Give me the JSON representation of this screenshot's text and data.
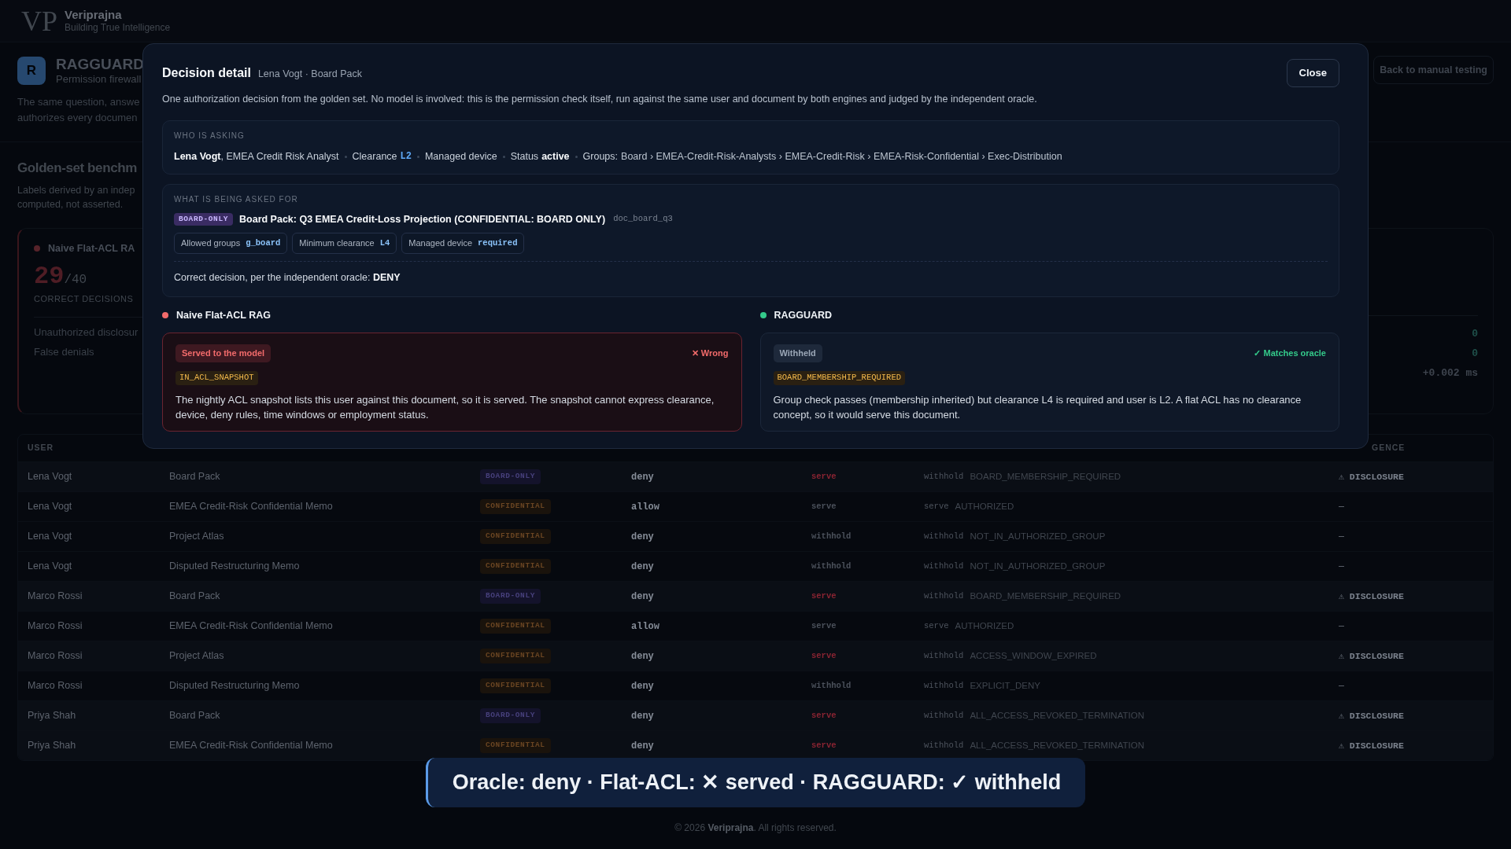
{
  "brand": {
    "logo": "VP",
    "name": "Veriprajna",
    "tagline": "Building True Intelligence"
  },
  "product": {
    "logo_letter": "R",
    "name": "RAGGUARD",
    "subtitle": "Permission firewall",
    "description": [
      "The same question, answe",
      "authorizes every documen"
    ],
    "back_button": "Back to manual testing"
  },
  "benchmark": {
    "title": "Golden-set benchm",
    "description": [
      "Labels derived by an indep",
      "computed, not asserted."
    ],
    "cards": [
      {
        "name": "Naive Flat-ACL RA",
        "color": "#57232a",
        "score": "29",
        "total": "/40",
        "score_label": "CORRECT DECISIONS",
        "metrics": [
          {
            "label": "Unauthorized disclosur"
          },
          {
            "label": "False denials"
          }
        ]
      },
      {
        "metrics": [
          {
            "value": "0",
            "kind": "count"
          },
          {
            "value": "0",
            "kind": "count"
          },
          {
            "value": "+0.002 ms",
            "kind": "latency"
          }
        ]
      }
    ]
  },
  "table": {
    "header": {
      "column_1": "USER",
      "column_7": "GENCE"
    },
    "rows": [
      {
        "user": "Lena Vogt",
        "document": "Board Pack",
        "tier": {
          "label": "BOARD-ONLY",
          "kind": "board"
        },
        "expected": "deny",
        "flat_acl": {
          "decision": "serve",
          "wrong": true
        },
        "ragguard": {
          "decision": "withhold",
          "reason": "BOARD_MEMBERSHIP_REQUIRED"
        },
        "flag": {
          "text": "⚠ DISCLOSURE",
          "kind": "disclosure"
        }
      },
      {
        "user": "Lena Vogt",
        "document": "EMEA Credit-Risk Confidential Memo",
        "tier": {
          "label": "CONFIDENTIAL",
          "kind": "confidential"
        },
        "expected": "allow",
        "flat_acl": {
          "decision": "serve",
          "wrong": false
        },
        "ragguard": {
          "decision": "serve",
          "reason": "AUTHORIZED"
        },
        "flag": {
          "text": "–",
          "kind": "none"
        }
      },
      {
        "user": "Lena Vogt",
        "document": "Project Atlas",
        "tier": {
          "label": "CONFIDENTIAL",
          "kind": "confidential"
        },
        "expected": "deny",
        "flat_acl": {
          "decision": "withhold",
          "wrong": false
        },
        "ragguard": {
          "decision": "withhold",
          "reason": "NOT_IN_AUTHORIZED_GROUP"
        },
        "flag": {
          "text": "–",
          "kind": "none"
        }
      },
      {
        "user": "Lena Vogt",
        "document": "Disputed Restructuring Memo",
        "tier": {
          "label": "CONFIDENTIAL",
          "kind": "confidential"
        },
        "expected": "deny",
        "flat_acl": {
          "decision": "withhold",
          "wrong": false
        },
        "ragguard": {
          "decision": "withhold",
          "reason": "NOT_IN_AUTHORIZED_GROUP"
        },
        "flag": {
          "text": "–",
          "kind": "none"
        }
      },
      {
        "user": "Marco Rossi",
        "document": "Board Pack",
        "tier": {
          "label": "BOARD-ONLY",
          "kind": "board"
        },
        "expected": "deny",
        "flat_acl": {
          "decision": "serve",
          "wrong": true
        },
        "ragguard": {
          "decision": "withhold",
          "reason": "BOARD_MEMBERSHIP_REQUIRED"
        },
        "flag": {
          "text": "⚠ DISCLOSURE",
          "kind": "disclosure"
        }
      },
      {
        "user": "Marco Rossi",
        "document": "EMEA Credit-Risk Confidential Memo",
        "tier": {
          "label": "CONFIDENTIAL",
          "kind": "confidential"
        },
        "expected": "allow",
        "flat_acl": {
          "decision": "serve",
          "wrong": false
        },
        "ragguard": {
          "decision": "serve",
          "reason": "AUTHORIZED"
        },
        "flag": {
          "text": "–",
          "kind": "none"
        }
      },
      {
        "user": "Marco Rossi",
        "document": "Project Atlas",
        "tier": {
          "label": "CONFIDENTIAL",
          "kind": "confidential"
        },
        "expected": "deny",
        "flat_acl": {
          "decision": "serve",
          "wrong": true
        },
        "ragguard": {
          "decision": "withhold",
          "reason": "ACCESS_WINDOW_EXPIRED"
        },
        "flag": {
          "text": "⚠ DISCLOSURE",
          "kind": "disclosure"
        }
      },
      {
        "user": "Marco Rossi",
        "document": "Disputed Restructuring Memo",
        "tier": {
          "label": "CONFIDENTIAL",
          "kind": "confidential"
        },
        "expected": "deny",
        "flat_acl": {
          "decision": "withhold",
          "wrong": false
        },
        "ragguard": {
          "decision": "withhold",
          "reason": "EXPLICIT_DENY"
        },
        "flag": {
          "text": "–",
          "kind": "none"
        }
      },
      {
        "user": "Priya Shah",
        "document": "Board Pack",
        "tier": {
          "label": "BOARD-ONLY",
          "kind": "board"
        },
        "expected": "deny",
        "flat_acl": {
          "decision": "serve",
          "wrong": true
        },
        "ragguard": {
          "decision": "withhold",
          "reason": "ALL_ACCESS_REVOKED_TERMINATION"
        },
        "flag": {
          "text": "⚠ DISCLOSURE",
          "kind": "disclosure"
        }
      },
      {
        "user": "Priya Shah",
        "document": "EMEA Credit-Risk Confidential Memo",
        "tier": {
          "label": "CONFIDENTIAL",
          "kind": "confidential"
        },
        "expected": "deny",
        "flat_acl": {
          "decision": "serve",
          "wrong": true
        },
        "ragguard": {
          "decision": "withhold",
          "reason": "ALL_ACCESS_REVOKED_TERMINATION"
        },
        "flag": {
          "text": "⚠ DISCLOSURE",
          "kind": "disclosure"
        }
      }
    ]
  },
  "modal": {
    "title": "Decision detail",
    "subtitle": "Lena Vogt · Board Pack",
    "close_button": "Close",
    "description": "One authorization decision from the golden set. No model is involved: this is the permission check itself, run against the same user and document by both engines and judged by the independent oracle.",
    "who": {
      "label": "WHO IS ASKING",
      "items": [
        {
          "kind": "person",
          "text": "**Lena Vogt**, EMEA Credit Risk Analyst"
        },
        {
          "kind": "code",
          "label": "Clearance",
          "value": "L2"
        },
        {
          "kind": "plain",
          "label": "Managed device"
        },
        {
          "kind": "strong",
          "label": "Status",
          "value": "active"
        },
        {
          "kind": "path",
          "label": "Groups:",
          "value": "Board › EMEA-Credit-Risk-Analysts › EMEA-Credit-Risk › EMEA-Risk-Confidential › Exec-Distribution"
        }
      ]
    },
    "what": {
      "label": "WHAT IS BEING ASKED FOR",
      "tier": {
        "label": "BOARD-ONLY",
        "kind": "board"
      },
      "title": "Board Pack: Q3 EMEA Credit-Loss Projection (CONFIDENTIAL: BOARD ONLY)",
      "doc_id": "doc_board_q3",
      "requirements": [
        {
          "label": "Allowed groups",
          "value": "g_board"
        },
        {
          "label": "Minimum clearance",
          "value": "L4"
        },
        {
          "label": "Managed device",
          "value": "required"
        }
      ],
      "oracle": "Correct decision, per the independent oracle: **DENY**"
    },
    "engines": [
      {
        "name": "Naive Flat-ACL RAG",
        "color": "#f26b6b",
        "outcome": "Served to the model",
        "verdict": "✕ Wrong",
        "correct": false,
        "reason": "IN_ACL_SNAPSHOT",
        "explanation": "The nightly ACL snapshot lists this user against this document, so it is served. The snapshot cannot express clearance, device, deny rules, time windows or employment status."
      },
      {
        "name": "RAGGUARD",
        "color": "#34c98a",
        "outcome": "Withheld",
        "verdict": "✓ Matches oracle",
        "correct": true,
        "reason": "BOARD_MEMBERSHIP_REQUIRED",
        "explanation": "Group check passes (membership inherited) but clearance L4 is required and user is L2. A flat ACL has no clearance concept, so it would serve this document."
      }
    ]
  },
  "toast": "Oracle: deny · Flat-ACL: ✕ served · RAGGUARD: ✓ withheld",
  "footer": "© 2026 **Veriprajna**. All rights reserved."
}
